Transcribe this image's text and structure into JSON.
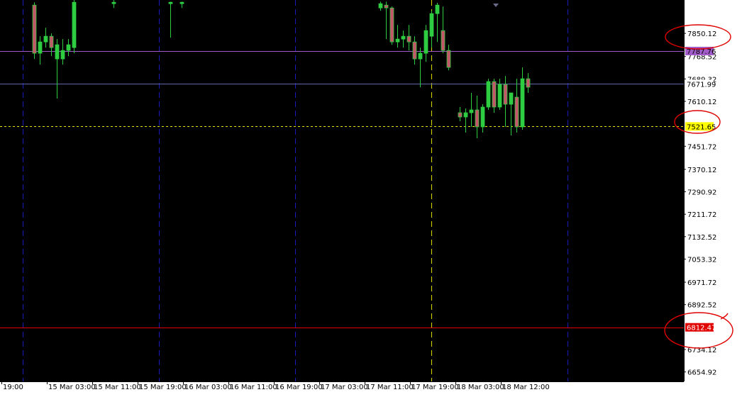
{
  "colors": {
    "background": "#000000",
    "axis_panel": "#ffffff",
    "axis_text": "#000000",
    "bull_candle": "#2ecc40",
    "bear_candle": "#c4566a",
    "wick": "#2ecc40",
    "period_separator": "#1a1ab8",
    "current_separator": "#d8d800",
    "purple_line": "#a05bc9",
    "blue_line": "#5a6aa8",
    "yellow_line": "#e6e600",
    "red_line": "#e00000",
    "annotation": "#e00000"
  },
  "chart_data": {
    "type": "candlestick",
    "ylim": [
      6634.0,
      7958.0
    ],
    "y_ticks": [
      "7850.12",
      "7768.52",
      "7689.32",
      "7610.12",
      "7451.72",
      "7370.12",
      "7290.92",
      "7211.72",
      "7132.52",
      "7053.32",
      "6971.72",
      "6892.52",
      "6734.12",
      "6654.92"
    ],
    "x_ticks": [
      "19:00",
      "15 Mar 03:00",
      "15 Mar 11:00",
      "15 Mar 19:00",
      "16 Mar 03:00",
      "16 Mar 11:00",
      "16 Mar 19:00",
      "17 Mar 03:00",
      "17 Mar 11:00",
      "17 Mar 19:00",
      "18 Mar 03:00",
      "18 Mar 12:00"
    ],
    "x_tick_index": [
      0,
      8,
      16,
      24,
      32,
      40,
      48,
      56,
      64,
      72,
      80,
      88
    ],
    "separators_index": [
      3,
      27,
      51,
      75,
      99
    ],
    "current_separator_index": 75,
    "price_lines": [
      {
        "value": 7787.76,
        "label": "7787.76",
        "style": "solid",
        "color": "purple_line",
        "label_bg": "#a05bc9",
        "label_fg": "#000000"
      },
      {
        "value": 7671.99,
        "label": "7671.99",
        "style": "solid",
        "color": "blue_line",
        "label_bg": "#ffffff",
        "label_fg": "#000000"
      },
      {
        "value": 7521.65,
        "label": "7521.65",
        "style": "dashed",
        "color": "yellow_line",
        "label_bg": "#ffff00",
        "label_fg": "#000000"
      },
      {
        "value": 6812.47,
        "label": "6812.47",
        "style": "solid",
        "color": "red_line",
        "label_bg": "#e00000",
        "label_fg": "#ffffff"
      }
    ],
    "candles": [
      {
        "i": 5,
        "o": 7950,
        "h": 7960,
        "l": 7760,
        "c": 7780
      },
      {
        "i": 6,
        "o": 7780,
        "h": 7840,
        "l": 7740,
        "c": 7820
      },
      {
        "i": 7,
        "o": 7820,
        "h": 7870,
        "l": 7800,
        "c": 7840
      },
      {
        "i": 8,
        "o": 7840,
        "h": 7850,
        "l": 7770,
        "c": 7800
      },
      {
        "i": 9,
        "o": 7760,
        "h": 7830,
        "l": 7620,
        "c": 7810
      },
      {
        "i": 10,
        "o": 7760,
        "h": 7830,
        "l": 7740,
        "c": 7790
      },
      {
        "i": 11,
        "o": 7790,
        "h": 7830,
        "l": 7770,
        "c": 7810
      },
      {
        "i": 12,
        "o": 7800,
        "h": 7980,
        "l": 7780,
        "c": 7960
      },
      {
        "i": 19,
        "o": 7955,
        "h": 7968,
        "l": 7940,
        "c": 7960
      },
      {
        "i": 29,
        "o": 7955,
        "h": 7962,
        "l": 7835,
        "c": 7960
      },
      {
        "i": 31,
        "o": 7955,
        "h": 7962,
        "l": 7940,
        "c": 7960
      },
      {
        "i": 66,
        "o": 7940,
        "h": 7962,
        "l": 7930,
        "c": 7955
      },
      {
        "i": 67,
        "o": 7950,
        "h": 7962,
        "l": 7830,
        "c": 7940
      },
      {
        "i": 68,
        "o": 7940,
        "h": 7945,
        "l": 7810,
        "c": 7820
      },
      {
        "i": 69,
        "o": 7820,
        "h": 7880,
        "l": 7800,
        "c": 7830
      },
      {
        "i": 70,
        "o": 7830,
        "h": 7860,
        "l": 7800,
        "c": 7840
      },
      {
        "i": 71,
        "o": 7840,
        "h": 7880,
        "l": 7790,
        "c": 7820
      },
      {
        "i": 72,
        "o": 7820,
        "h": 7840,
        "l": 7740,
        "c": 7760
      },
      {
        "i": 73,
        "o": 7760,
        "h": 7800,
        "l": 7660,
        "c": 7780
      },
      {
        "i": 74,
        "o": 7780,
        "h": 7880,
        "l": 7750,
        "c": 7860
      },
      {
        "i": 75,
        "o": 7840,
        "h": 7930,
        "l": 7800,
        "c": 7920
      },
      {
        "i": 76,
        "o": 7920,
        "h": 7958,
        "l": 7820,
        "c": 7950
      },
      {
        "i": 77,
        "o": 7860,
        "h": 7945,
        "l": 7780,
        "c": 7790
      },
      {
        "i": 78,
        "o": 7790,
        "h": 7810,
        "l": 7720,
        "c": 7730
      },
      {
        "i": 80,
        "o": 7570,
        "h": 7590,
        "l": 7540,
        "c": 7555
      },
      {
        "i": 81,
        "o": 7555,
        "h": 7585,
        "l": 7500,
        "c": 7570
      },
      {
        "i": 82,
        "o": 7570,
        "h": 7640,
        "l": 7520,
        "c": 7580
      },
      {
        "i": 83,
        "o": 7580,
        "h": 7630,
        "l": 7480,
        "c": 7520
      },
      {
        "i": 84,
        "o": 7520,
        "h": 7600,
        "l": 7500,
        "c": 7590
      },
      {
        "i": 85,
        "o": 7590,
        "h": 7690,
        "l": 7580,
        "c": 7680
      },
      {
        "i": 86,
        "o": 7680,
        "h": 7690,
        "l": 7570,
        "c": 7590
      },
      {
        "i": 87,
        "o": 7590,
        "h": 7690,
        "l": 7580,
        "c": 7670
      },
      {
        "i": 88,
        "o": 7670,
        "h": 7700,
        "l": 7520,
        "c": 7600
      },
      {
        "i": 89,
        "o": 7600,
        "h": 7620,
        "l": 7490,
        "c": 7640
      },
      {
        "i": 90,
        "o": 7625,
        "h": 7690,
        "l": 7500,
        "c": 7520
      },
      {
        "i": 91,
        "o": 7520,
        "h": 7730,
        "l": 7510,
        "c": 7690
      },
      {
        "i": 92,
        "o": 7690,
        "h": 7710,
        "l": 7640,
        "c": 7660
      }
    ]
  }
}
